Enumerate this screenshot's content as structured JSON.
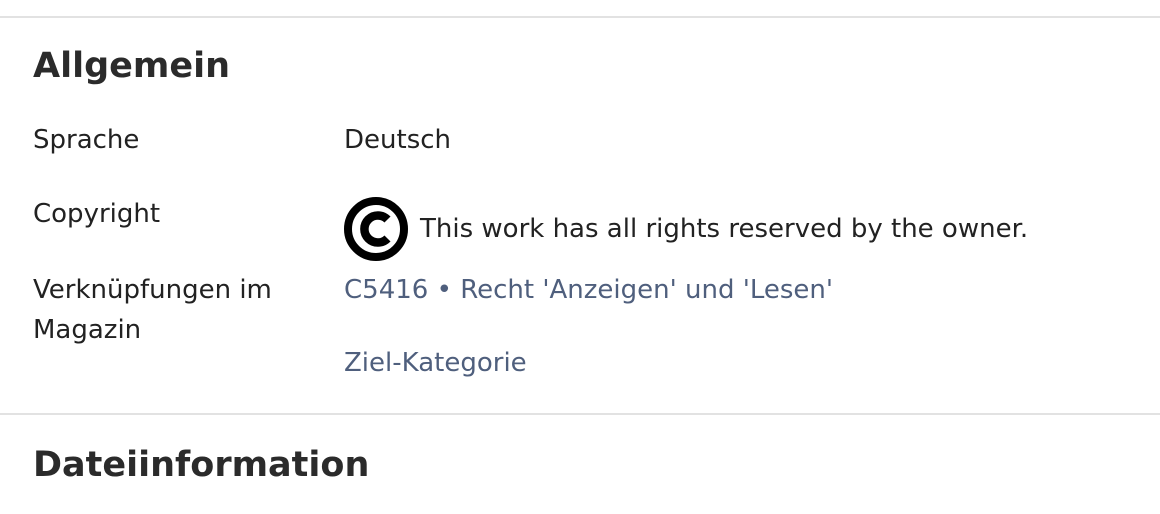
{
  "sections": {
    "general": {
      "title": "Allgemein",
      "rows": {
        "language": {
          "label": "Sprache",
          "value": "Deutsch"
        },
        "copyright": {
          "label": "Copyright",
          "icon": "copyright-icon",
          "value": "This work has all rights reserved by the owner."
        },
        "links": {
          "label": "Verknüpfungen im Magazin",
          "items": [
            {
              "text": "C5416 • Recht 'Anzeigen' und 'Lesen'"
            },
            {
              "text": "Ziel-Kategorie"
            }
          ]
        }
      }
    },
    "file_info": {
      "title": "Dateiinformation"
    }
  },
  "colors": {
    "link": "#4f5f7d",
    "text": "#222222",
    "divider": "#e2e2e2"
  }
}
